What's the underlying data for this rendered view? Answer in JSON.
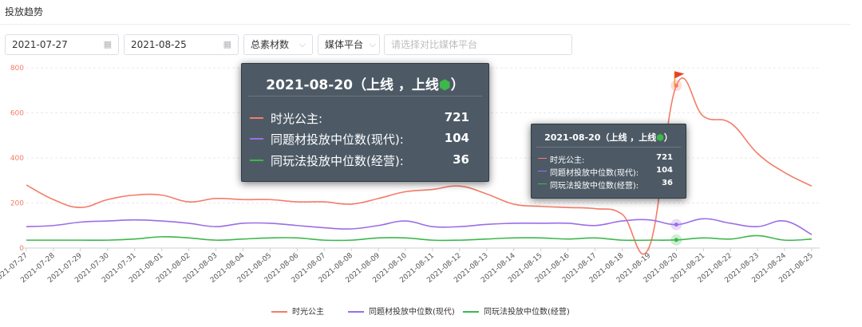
{
  "header": {
    "title": "投放趋势"
  },
  "filters": {
    "start_date": "2021-07-27",
    "end_date": "2021-08-25",
    "metric_select": "总素材数",
    "platform_select": "媒体平台",
    "compare_placeholder": "请选择对比媒体平台"
  },
  "icons": {
    "calendar": "calendar-icon",
    "dropdown": "chevron-down-icon",
    "apple": "apple-icon",
    "android": "android-icon",
    "flag": "flag-icon"
  },
  "colors": {
    "series1": "#f47c68",
    "series2": "#9b6ee6",
    "series3": "#3db84a"
  },
  "tooltip": {
    "title_date": "2021-08-20",
    "title_open": "（上线",
    "title_mid": "，上线",
    "title_close": "）",
    "rows": [
      {
        "name": "时光公主:",
        "value": "721"
      },
      {
        "name": "同题材投放中位数(现代):",
        "value": "104"
      },
      {
        "name": "同玩法投放中位数(经营):",
        "value": "36"
      }
    ]
  },
  "chart_data": {
    "type": "line",
    "categories": [
      "2021-07-27",
      "2021-07-28",
      "2021-07-29",
      "2021-07-30",
      "2021-07-31",
      "2021-08-01",
      "2021-08-02",
      "2021-08-03",
      "2021-08-04",
      "2021-08-05",
      "2021-08-06",
      "2021-08-07",
      "2021-08-08",
      "2021-08-09",
      "2021-08-10",
      "2021-08-11",
      "2021-08-12",
      "2021-08-13",
      "2021-08-14",
      "2021-08-15",
      "2021-08-16",
      "2021-08-17",
      "2021-08-18",
      "2021-08-19",
      "2021-08-20",
      "2021-08-21",
      "2021-08-22",
      "2021-08-23",
      "2021-08-24",
      "2021-08-25"
    ],
    "series": [
      {
        "name": "时光公主",
        "values": [
          280,
          215,
          180,
          215,
          235,
          235,
          205,
          220,
          215,
          215,
          205,
          205,
          195,
          220,
          250,
          260,
          275,
          240,
          195,
          185,
          180,
          175,
          150,
          5,
          721,
          585,
          555,
          420,
          335,
          275
        ]
      },
      {
        "name": "同题材投放中位数(现代)",
        "values": [
          95,
          100,
          115,
          120,
          125,
          120,
          110,
          95,
          110,
          110,
          100,
          90,
          85,
          100,
          120,
          95,
          95,
          105,
          110,
          110,
          110,
          100,
          120,
          125,
          104,
          130,
          110,
          95,
          120,
          60
        ]
      },
      {
        "name": "同玩法投放中位数(经营)",
        "values": [
          35,
          35,
          35,
          35,
          40,
          50,
          45,
          35,
          40,
          45,
          45,
          35,
          35,
          45,
          45,
          35,
          35,
          40,
          45,
          45,
          40,
          45,
          35,
          35,
          36,
          45,
          40,
          55,
          35,
          40
        ]
      }
    ],
    "yticks": [
      0,
      200,
      400,
      600,
      800
    ],
    "ylim": [
      0,
      800
    ],
    "grid": true,
    "legend": "bottom-center",
    "highlight": {
      "category": "2021-08-20"
    }
  }
}
